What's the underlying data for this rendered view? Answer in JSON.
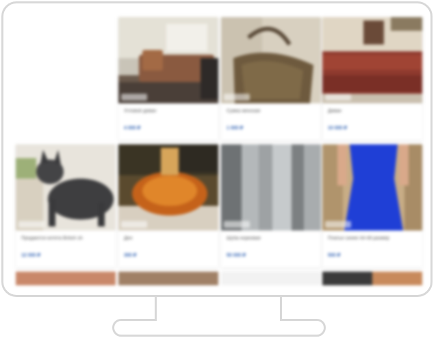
{
  "colors": {
    "frame": "#d8d8d8",
    "price": "#2a5db0",
    "title": "#555555"
  },
  "listings": [
    {
      "title": "Угловой диван",
      "price": "4 000 ₽",
      "image": "living-room-sofa"
    },
    {
      "title": "Сумка женская",
      "price": "1 000 ₽",
      "image": "leather-handbag"
    },
    {
      "title": "Диван",
      "price": "10 000 ₽",
      "image": "red-leather-sofa"
    },
    {
      "title": "Продаются котята British sh",
      "price": "12 000 ₽",
      "image": "gray-kitten"
    },
    {
      "title": "Ден",
      "price": "300 ₽",
      "image": "amber-glass-decanter"
    },
    {
      "title": "Шуба норковая",
      "price": "50 000 ₽",
      "image": "gray-mink-coat"
    },
    {
      "title": "Платье синее 44-46 размер",
      "price": "500 ₽",
      "image": "blue-dress"
    }
  ]
}
